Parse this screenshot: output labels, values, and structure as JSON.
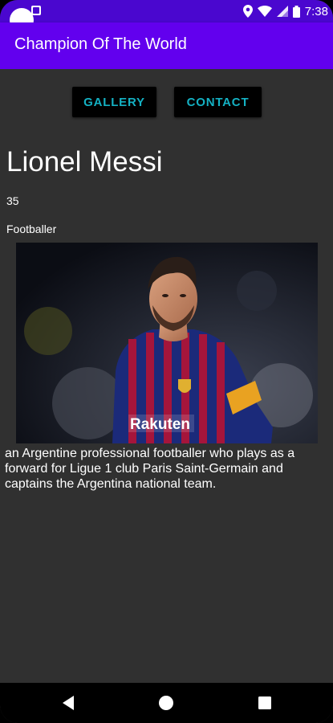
{
  "status_bar": {
    "time": "7:38",
    "icons": [
      "notification-icon",
      "location-icon",
      "wifi-icon",
      "signal-icon",
      "battery-icon"
    ]
  },
  "app_bar": {
    "title": "Champion Of The World"
  },
  "buttons": {
    "gallery_label": "GALLERY",
    "contact_label": "CONTACT"
  },
  "profile": {
    "name": "Lionel Messi",
    "age": "35",
    "profession": "Footballer",
    "description": "an Argentine professional footballer who plays as a forward for Ligue 1 club Paris Saint-Germain and captains the Argentina national team."
  },
  "photo": {
    "subject": "player-photo",
    "jersey_sponsor": "Rakuten"
  },
  "nav_bar": {
    "icons": [
      "back-icon",
      "home-icon",
      "recents-icon"
    ]
  },
  "colors": {
    "status_bar": "#4a07cf",
    "app_bar": "#6200ee",
    "background": "#303030",
    "button_bg": "#000000",
    "button_text": "#14b1c3",
    "text": "#ffffff"
  }
}
